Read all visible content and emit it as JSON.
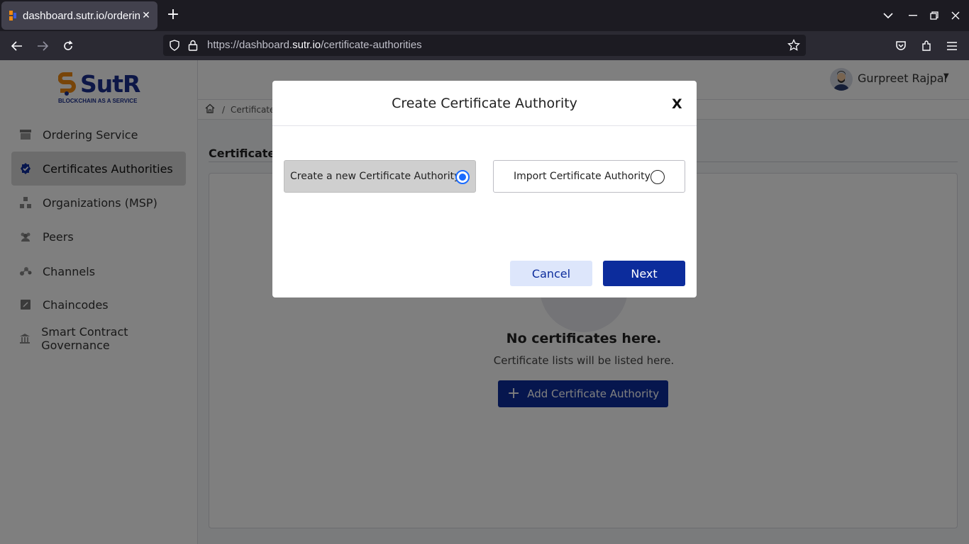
{
  "browser": {
    "tab_title": "dashboard.sutr.io/ordering",
    "url_prefix": "https://dashboard.",
    "url_host": "sutr.io",
    "url_path": "/certificate-authorities"
  },
  "app": {
    "logo_text": "SutR",
    "logo_subtitle": "BLOCKCHAIN AS A SERVICE",
    "user_name": "Gurpreet Rajpal"
  },
  "sidebar": {
    "items": [
      {
        "label": "Ordering Service",
        "icon": "archive-box-icon"
      },
      {
        "label": "Certificates Authorities",
        "icon": "verified-badge-icon"
      },
      {
        "label": "Organizations (MSP)",
        "icon": "hierarchy-icon"
      },
      {
        "label": "Peers",
        "icon": "users-group-icon"
      },
      {
        "label": "Channels",
        "icon": "network-icon"
      },
      {
        "label": "Chaincodes",
        "icon": "document-icon"
      },
      {
        "label": "Smart Contract Governance",
        "icon": "bank-icon"
      }
    ]
  },
  "breadcrumb": {
    "separator": "/",
    "current": "Certificate"
  },
  "page": {
    "heading": "Certificate A",
    "empty_title": "No certificates here.",
    "empty_subtitle": "Certificate lists will be listed here.",
    "add_button": "Add Certificate Authority"
  },
  "modal": {
    "title": "Create Certificate Authority",
    "close_label": "X",
    "option_new": "Create a new Certificate Authority",
    "option_import": "Import Certificate Authority",
    "cancel_label": "Cancel",
    "next_label": "Next"
  },
  "colors": {
    "brand_primary": "#0c2c9c",
    "brand_accent": "#f08a12",
    "radio_selected": "#1a6bff"
  }
}
